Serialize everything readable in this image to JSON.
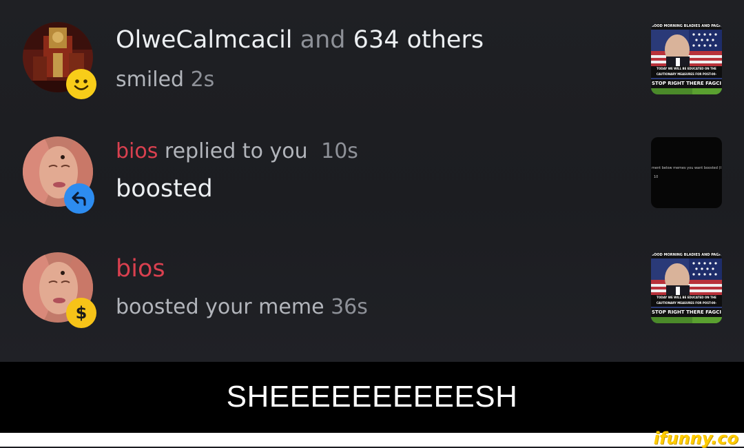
{
  "notifications": [
    {
      "actor": "OlweCalmcacil",
      "connector": "and",
      "others": "634 others",
      "action": "smiled",
      "time": "2s",
      "badge_icon": "smile-icon",
      "thumbnail": {
        "top": "GOOD MORNING BLADIES AND PAGANMEN",
        "middle": "TODAY WE WILL BE EDUCATED ON THE CAUTIONARY MEASURES FOR POST-00-",
        "bottom": "STOP RIGHT THERE FAGCI"
      }
    },
    {
      "actor": "bios",
      "action": "replied to you",
      "time": "10s",
      "message": "boosted",
      "badge_icon": "reply-arrow-icon",
      "thumbnail": {
        "line1": "ment below memes you want boosted (I",
        "line2": "10"
      }
    },
    {
      "actor": "bios",
      "action": "boosted your meme",
      "time": "36s",
      "badge_icon": "dollar-icon",
      "badge_text": "$",
      "thumbnail": {
        "top": "GOOD MORNING BLADIES AND PAGANMEN",
        "middle": "TODAY WE WILL BE EDUCATED ON THE CAUTIONARY MEASURES FOR POST-00-",
        "bottom": "STOP RIGHT THERE FAGCI"
      }
    }
  ],
  "caption": "SHEEEEEEEEEESH",
  "watermark": "ifunny.co",
  "colors": {
    "background": "#1c1d21",
    "actor_red": "#d9404f",
    "smile_badge": "#f8cd19",
    "reply_badge": "#2d8cf0",
    "dollar_badge": "#f6c318",
    "caption_bar": "#000000",
    "watermark": "#ffcc00"
  }
}
